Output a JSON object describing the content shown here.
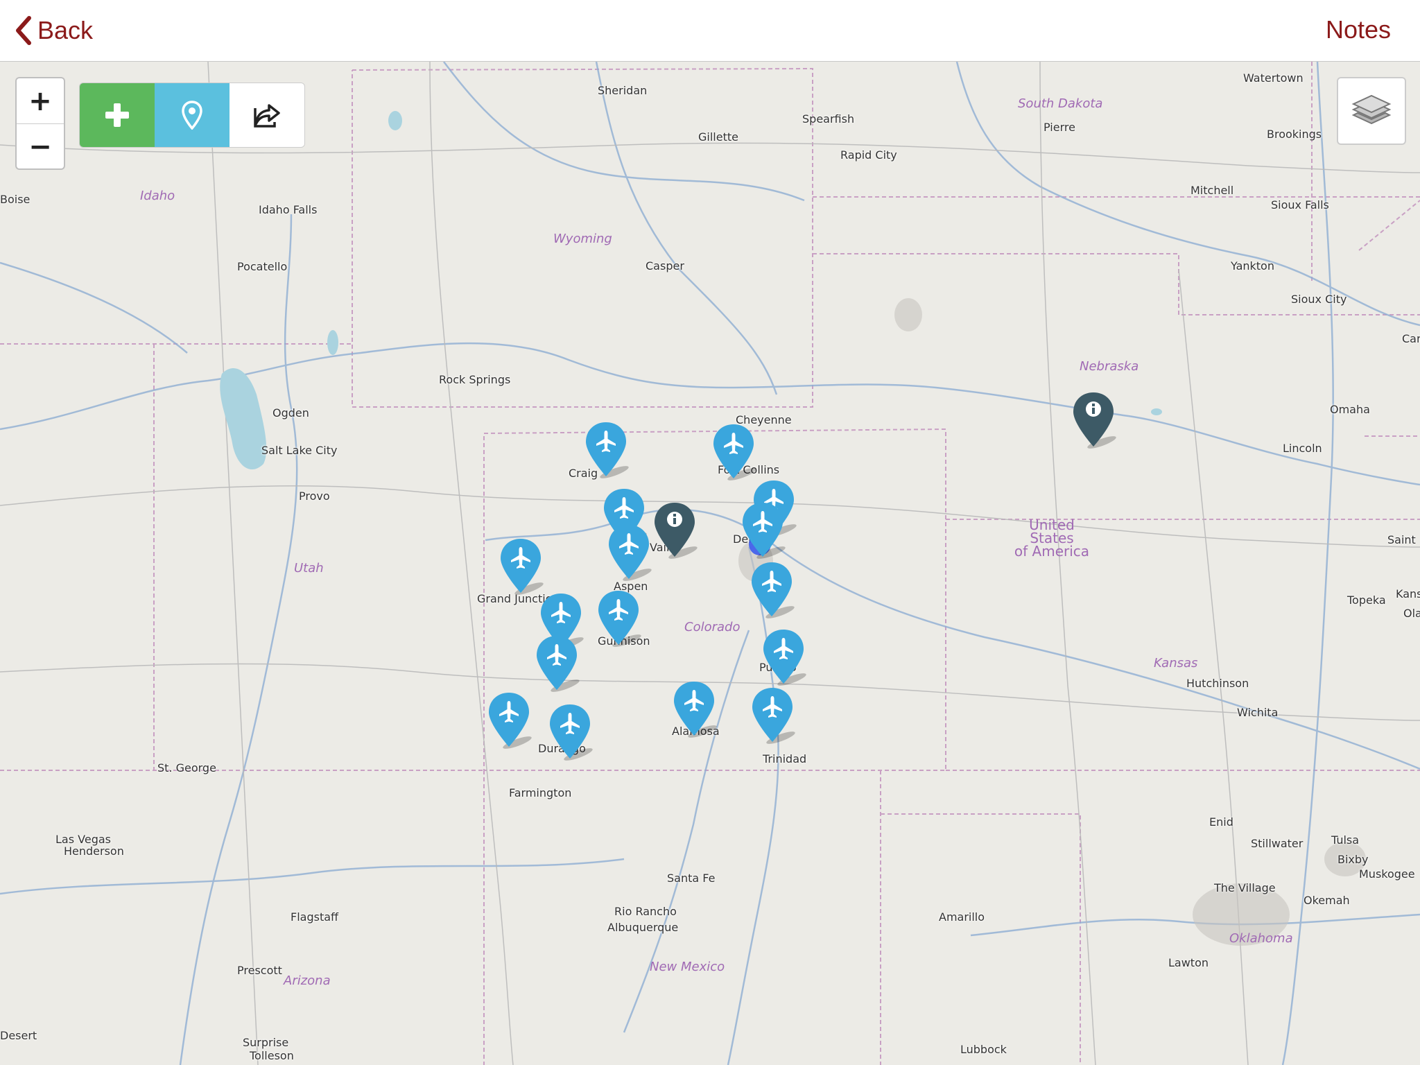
{
  "nav": {
    "back_label": "Back",
    "notes_label": "Notes",
    "accent_color": "#8b1a1a"
  },
  "map_controls": {
    "zoom_in": "+",
    "zoom_out": "−",
    "add_color": "#5cb85c",
    "locate_color": "#5bc0de"
  },
  "cities": [
    {
      "name": "Sheridan"
    },
    {
      "name": "Gillette"
    },
    {
      "name": "Spearfish"
    },
    {
      "name": "Rapid City"
    },
    {
      "name": "Pierre"
    },
    {
      "name": "Watertown"
    },
    {
      "name": "Brookings"
    },
    {
      "name": "Mitchell"
    },
    {
      "name": "Sioux Falls"
    },
    {
      "name": "Yankton"
    },
    {
      "name": "Sioux City"
    },
    {
      "name": "Boise"
    },
    {
      "name": "Idaho Falls"
    },
    {
      "name": "Pocatello"
    },
    {
      "name": "Casper"
    },
    {
      "name": "Rock Springs"
    },
    {
      "name": "Ogden"
    },
    {
      "name": "Salt Lake City"
    },
    {
      "name": "Provo"
    },
    {
      "name": "Cheyenne"
    },
    {
      "name": "Fort Collins"
    },
    {
      "name": "Craig"
    },
    {
      "name": "Vail"
    },
    {
      "name": "Denver"
    },
    {
      "name": "Aspen"
    },
    {
      "name": "Grand Junction"
    },
    {
      "name": "Gunnison"
    },
    {
      "name": "Pueblo"
    },
    {
      "name": "Durango"
    },
    {
      "name": "Alamosa"
    },
    {
      "name": "Trinidad"
    },
    {
      "name": "Farmington"
    },
    {
      "name": "St. George"
    },
    {
      "name": "Las Vegas"
    },
    {
      "name": "Henderson"
    },
    {
      "name": "Santa Fe"
    },
    {
      "name": "Rio Rancho"
    },
    {
      "name": "Albuquerque"
    },
    {
      "name": "Flagstaff"
    },
    {
      "name": "Prescott"
    },
    {
      "name": "Surprise"
    },
    {
      "name": "Tolleson"
    },
    {
      "name": "Amarillo"
    },
    {
      "name": "Lubbock"
    },
    {
      "name": "Lawton"
    },
    {
      "name": "Omaha"
    },
    {
      "name": "Lincoln"
    },
    {
      "name": "Topeka"
    },
    {
      "name": "Hutchinson"
    },
    {
      "name": "Wichita"
    },
    {
      "name": "Enid"
    },
    {
      "name": "Stillwater"
    },
    {
      "name": "Tulsa"
    },
    {
      "name": "Bixby"
    },
    {
      "name": "Muskogee"
    },
    {
      "name": "The Village"
    },
    {
      "name": "Okemah"
    },
    {
      "name": "Saint"
    },
    {
      "name": "Kans"
    },
    {
      "name": "Ola"
    },
    {
      "name": "Car"
    },
    {
      "name": "Desert"
    }
  ],
  "regions": [
    {
      "name": "South Dakota"
    },
    {
      "name": "Idaho"
    },
    {
      "name": "Wyoming"
    },
    {
      "name": "Nebraska"
    },
    {
      "name": "Utah"
    },
    {
      "name": "Colorado"
    },
    {
      "name": "Kansas"
    },
    {
      "name": "Arizona"
    },
    {
      "name": "New Mexico"
    },
    {
      "name": "Oklahoma"
    }
  ],
  "country_label": "United States of America",
  "country_lines": [
    "United",
    "States",
    "of America"
  ],
  "pins": {
    "airport_color": "#3aa6dd",
    "info_color": "#3d5a66",
    "airport_count": 16,
    "info_count": 2
  }
}
